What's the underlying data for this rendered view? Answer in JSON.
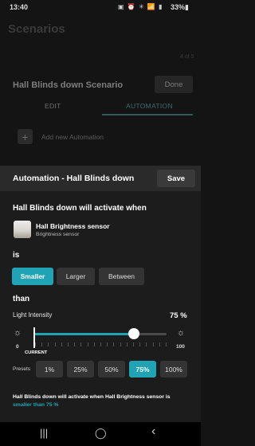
{
  "status_bar": {
    "time": "13:40",
    "icons": "▣ ⏰ ✳ 📶 ▮",
    "battery": "33%▮"
  },
  "background": {
    "page_title": "Scenarios",
    "count": "4 of 5",
    "scenario_title": "Hall Blinds down Scenario",
    "done_label": "Done",
    "tabs": [
      {
        "label": "EDIT"
      },
      {
        "label": "AUTOMATION"
      }
    ],
    "add_automation_label": "Add new Automation"
  },
  "sheet": {
    "title": "Automation - Hall Blinds down",
    "save_label": "Save",
    "activate_text": "Hall Blinds down will activate when",
    "sensor": {
      "name": "Hall Brightness sensor",
      "type": "Brightness sensor"
    },
    "is_label": "is",
    "comparators": [
      {
        "label": "Smaller",
        "selected": true
      },
      {
        "label": "Larger",
        "selected": false
      },
      {
        "label": "Between",
        "selected": false
      }
    ],
    "than_label": "than",
    "intensity": {
      "label": "Light Intensity",
      "value_text": "75 %",
      "value": 75,
      "min_label": "0",
      "max_label": "100",
      "current_label": "CURRENT",
      "current_value": 0
    },
    "presets_label": "Presets",
    "presets": [
      {
        "label": "1%",
        "selected": false
      },
      {
        "label": "25%",
        "selected": false
      },
      {
        "label": "50%",
        "selected": false
      },
      {
        "label": "75%",
        "selected": true
      },
      {
        "label": "100%",
        "selected": false
      }
    ],
    "summary": {
      "prefix": "Hall Blinds down will activate when Hall Brightness sensor is ",
      "highlight": "smaller than 75 %"
    }
  },
  "nav": {
    "recents_icon": "|||",
    "home_icon": "◯",
    "back_icon": "‹"
  },
  "colors": {
    "accent": "#1fa3b5",
    "sheet_bg": "#1c1c1c",
    "chip_bg": "#343434"
  }
}
